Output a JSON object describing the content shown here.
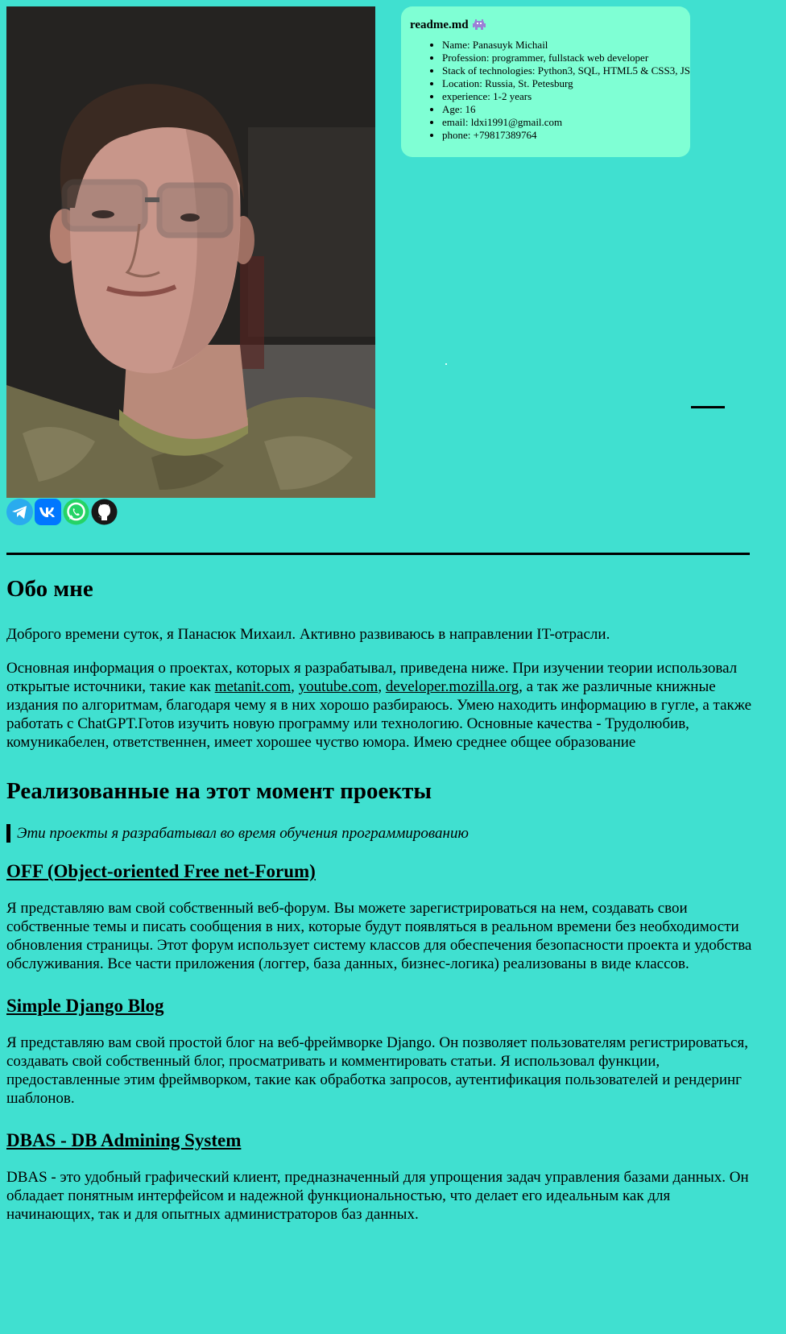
{
  "readme": {
    "title": "readme.md",
    "items": [
      "Name: Panasuyk Michail",
      "Profession: programmer, fullstack web developer",
      "Stack of technologies: Python3, SQL, HTML5 & CSS3, JS",
      "Location: Russia, St. Petesburg",
      "experience: 1-2 years",
      "Age: 16",
      "email: ldxi1991@gmail.com",
      "phone: +79817389764"
    ]
  },
  "colors": {
    "page_bg": "#40E0D0",
    "card_bg": "#7FFFD4",
    "telegram": "#2AABEE",
    "vk": "#0077FF",
    "whatsapp": "#25D366",
    "github": "#181717"
  },
  "socials": [
    {
      "name": "telegram",
      "icon": "telegram-icon"
    },
    {
      "name": "vk",
      "icon": "vk-icon"
    },
    {
      "name": "whatsapp",
      "icon": "whatsapp-icon"
    },
    {
      "name": "github",
      "icon": "github-icon"
    }
  ],
  "about": {
    "title": "Обо мне",
    "intro": "Доброго времени суток, я Панасюк Михаил. Активно развиваюсь в направлении IT-отрасли.",
    "desc_before": "Основная информация о проектах, которых я разрабатывал, приведена ниже. При изучении теории использовал открытые источники, такие как ",
    "link1": "metanit.com",
    "sep1": ", ",
    "link2": "youtube.com",
    "sep2": ", ",
    "link3": "developer.mozilla.org",
    "desc_after": ", а так же различные книжные издания по алгоритмам, благодаря чему я в них хорошо разбираюсь. Умею находить информацию в гугле, а также работать с ChatGPT.Готов изучить новую программу или технологию. Основные качества - Трудолюбив, комуникабелен, ответственнен, имеет хорошее чуство юмора. Имею среднее общее образование"
  },
  "projects": {
    "title": "Реализованные на этот момент проекты",
    "quote": "Эти проекты я разрабатывал во время обучения программированию",
    "items": [
      {
        "title": "OFF (Object-oriented Free net-Forum)",
        "text": "Я представляю вам свой собственный веб-форум. Вы можете зарегистрироваться на нем, создавать свои собственные темы и писать сообщения в них, которые будут появляться в реальном времени без необходимости обновления страницы. Этот форум использует систему классов для обеспечения безопасности проекта и удобства обслуживания. Все части приложения (логгер, база данных, бизнес-логика) реализованы в виде классов."
      },
      {
        "title": "Simple Django Blog",
        "text": "Я представляю вам свой простой блог на веб-фреймворке Django. Он позволяет пользователям регистрироваться, создавать свой собственный блог, просматривать и комментировать статьи. Я использовал функции, предоставленные этим фреймворком, такие как обработка запросов, аутентификация пользователей и рендеринг шаблонов."
      },
      {
        "title": "DBAS - DB Admining System",
        "text": "DBAS - это удобный графический клиент, предназначенный для упрощения задач управления базами данных. Он обладает понятным интерфейсом и надежной функциональностью, что делает его идеальным как для начинающих, так и для опытных администраторов баз данных."
      }
    ]
  }
}
